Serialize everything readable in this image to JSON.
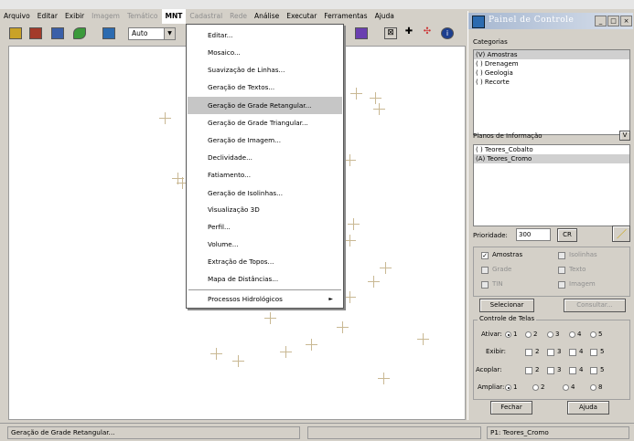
{
  "menubar": {
    "items": [
      {
        "label": "Arquivo",
        "state": "enabled"
      },
      {
        "label": "Editar",
        "state": "enabled"
      },
      {
        "label": "Exibir",
        "state": "enabled"
      },
      {
        "label": "Imagem",
        "state": "disabled"
      },
      {
        "label": "Temático",
        "state": "disabled"
      },
      {
        "label": "MNT",
        "state": "active"
      },
      {
        "label": "Cadastral",
        "state": "disabled"
      },
      {
        "label": "Rede",
        "state": "disabled"
      },
      {
        "label": "Análise",
        "state": "enabled"
      },
      {
        "label": "Executar",
        "state": "enabled"
      },
      {
        "label": "Ferramentas",
        "state": "enabled"
      },
      {
        "label": "Ajuda",
        "state": "enabled"
      }
    ]
  },
  "toolbar": {
    "zoom_value": "Auto",
    "colors": {
      "db": "#c9a227",
      "table": "#a33a2a",
      "layers": "#3a5fa8",
      "edit": "#3b9a3b",
      "nav": "#2c6bb0",
      "display": "#6a3fb0",
      "info": "#1d3f8f"
    }
  },
  "mnt_menu": {
    "items": [
      "Editar...",
      "Mosaico...",
      "Suavização de Linhas...",
      "Geração de Textos...",
      "Geração de Grade Retangular...",
      "Geração de Grade Triangular...",
      "Geração de Imagem...",
      "Declividade...",
      "Fatiamento...",
      "Geração de Isolinhas...",
      "Visualização 3D",
      "Perfil...",
      "Volume...",
      "Extração de Topos...",
      "Mapa de Distâncias...",
      "Processos Hidrológicos"
    ],
    "highlighted_index": 4
  },
  "panel": {
    "title": "Painel de Controle",
    "categorias_label": "Categorias",
    "categorias": [
      "(V) Amostras",
      "( ) Drenagem",
      "( ) Geologia",
      "( ) Recorte"
    ],
    "categorias_selected": 0,
    "planos_label": "Planos de Informação",
    "planos_button": "V",
    "planos": [
      "( ) Teores_Cobalto",
      "(A) Teores_Cromo"
    ],
    "planos_selected": 1,
    "prioridade_label": "Prioridade:",
    "prioridade_value": "300",
    "cr_button": "CR",
    "representations": [
      {
        "label": "Amostras",
        "checked": true,
        "enabled": true
      },
      {
        "label": "Isolinhas",
        "checked": false,
        "enabled": false
      },
      {
        "label": "Grade",
        "checked": false,
        "enabled": false
      },
      {
        "label": "Texto",
        "checked": false,
        "enabled": false
      },
      {
        "label": "TIN",
        "checked": false,
        "enabled": false
      },
      {
        "label": "Imagem",
        "checked": false,
        "enabled": false
      }
    ],
    "selecionar_button": "Selecionar",
    "consultar_button": "Consultar...",
    "controle_telas_label": "Controle de Telas",
    "ativar_label": "Ativar:",
    "exibir_label": "Exibir:",
    "acoplar_label": "Acoplar:",
    "ampliar_label": "Ampliar:",
    "screen_numbers": [
      "1",
      "2",
      "3",
      "4",
      "5"
    ],
    "ampliar_numbers": [
      "1",
      "2",
      "4",
      "8"
    ],
    "fechar_button": "Fechar",
    "ajuda_button": "Ajuda"
  },
  "status": {
    "left": "Geração de Grade Retangular...",
    "middle": "",
    "right": "P1: Teores_Cromo"
  }
}
